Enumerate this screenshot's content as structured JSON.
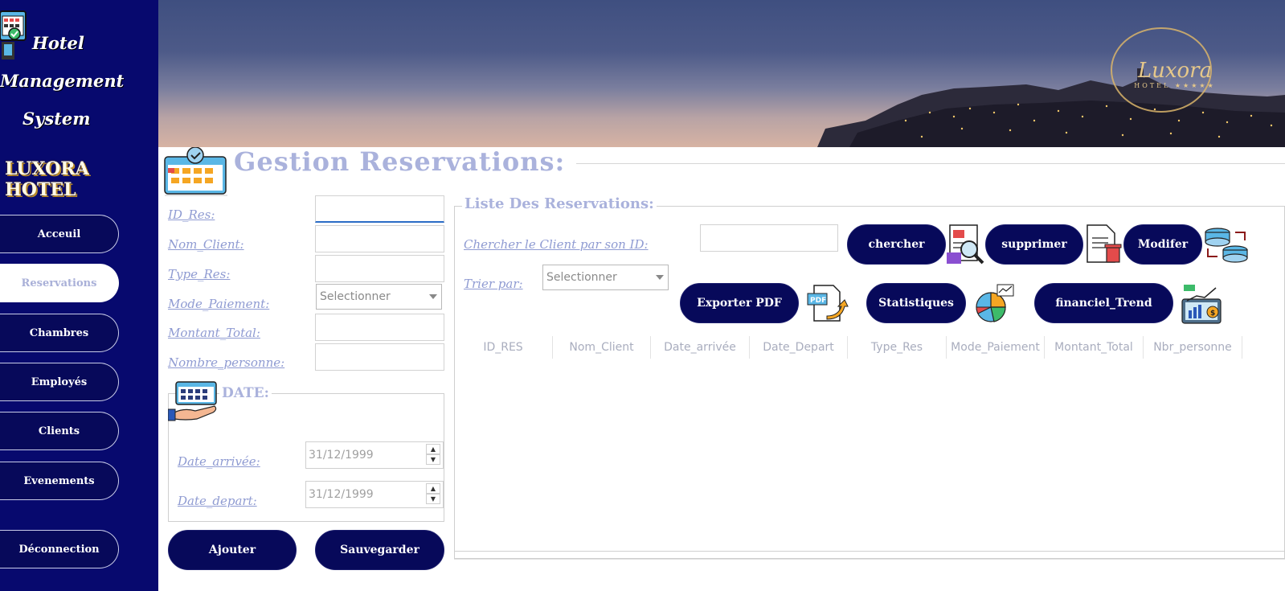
{
  "sidebar": {
    "app_title": [
      "Hotel",
      "Management",
      "System"
    ],
    "brand": "LUXORA HOTEL",
    "nav": [
      {
        "label": "Acceuil",
        "active": false
      },
      {
        "label": "Reservations",
        "active": true
      },
      {
        "label": "Chambres",
        "active": false
      },
      {
        "label": "Employés",
        "active": false
      },
      {
        "label": "Clients",
        "active": false
      },
      {
        "label": "Evenements",
        "active": false
      },
      {
        "label": "Déconnection",
        "active": false
      }
    ],
    "bg_color": "#07096e"
  },
  "header": {
    "logo_text": "Luxora",
    "logo_sub": "HOTEL",
    "logo_stars": "★★★★★"
  },
  "page": {
    "title": "Gestion Reservations:"
  },
  "form": {
    "fields": [
      {
        "label": "ID_Res:",
        "value": ""
      },
      {
        "label": "Nom_Client:",
        "value": ""
      },
      {
        "label": "Type_Res:",
        "value": ""
      },
      {
        "label": "Mode_Paiement:",
        "value": "Selectionner"
      },
      {
        "label": "Montant_Total:",
        "value": ""
      },
      {
        "label": "Nombre_personne:",
        "value": ""
      }
    ],
    "date_group": {
      "title": "DATE:",
      "arrival_label": "Date_arrivée:",
      "arrival_value": "31/12/1999",
      "departure_label": "Date_depart:",
      "departure_value": "31/12/1999"
    },
    "add_label": "Ajouter",
    "save_label": "Sauvegarder"
  },
  "list": {
    "title": "Liste Des Reservations:",
    "search_label": "Chercher le Client par son ID:",
    "search_value": "",
    "sort_label": "Trier par:",
    "sort_value": "Selectionner",
    "search_button": "chercher",
    "delete_button": "supprimer",
    "edit_button": "Modifer",
    "export_button": "Exporter PDF",
    "stats_button": "Statistiques",
    "trend_button": "financiel_Trend",
    "columns": [
      "ID_RES",
      "Nom_Client",
      "Date_arrivée",
      "Date_Depart",
      "Type_Res",
      "Mode_Paiement",
      "Montant_Total",
      "Nbr_personne"
    ],
    "rows": []
  },
  "colors": {
    "accent": "#07095a",
    "label": "#8f9bd2",
    "title": "#aab2dc"
  }
}
